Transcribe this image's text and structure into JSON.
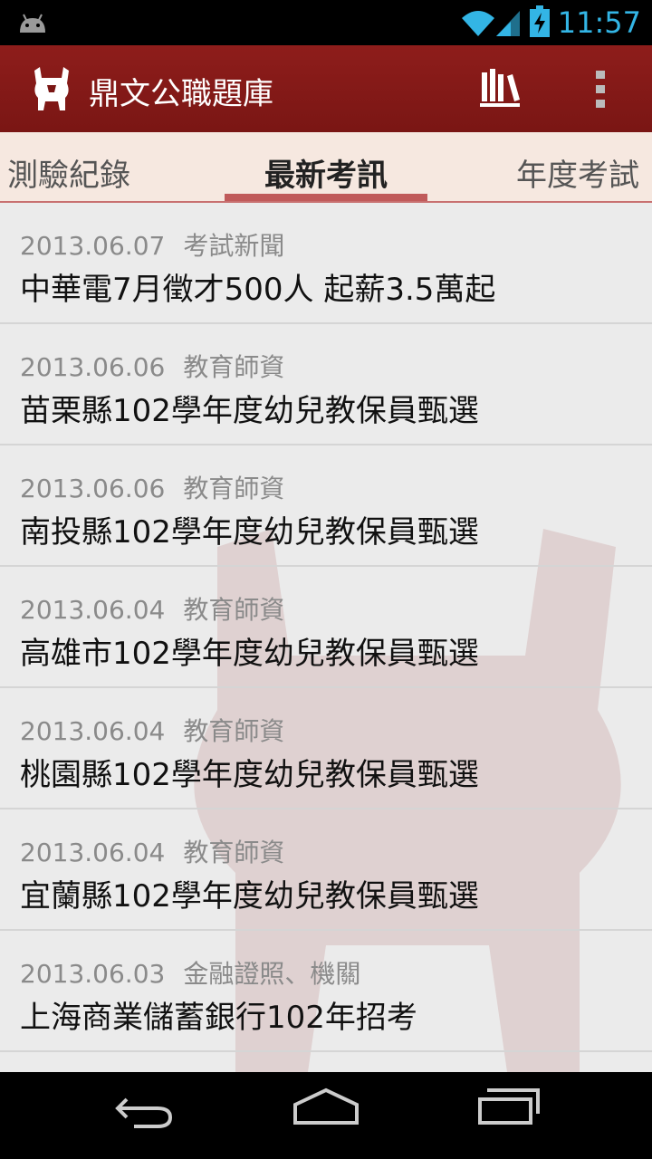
{
  "status": {
    "time": "11:57"
  },
  "app": {
    "title": "鼎文公職題庫"
  },
  "tabs": [
    "測驗紀錄",
    "最新考訊",
    "年度考試"
  ],
  "news": [
    {
      "date": "2013.06.07",
      "category": "考試新聞",
      "title": "中華電7月徵才500人 起薪3.5萬起"
    },
    {
      "date": "2013.06.06",
      "category": "教育師資",
      "title": "苗栗縣102學年度幼兒教保員甄選"
    },
    {
      "date": "2013.06.06",
      "category": "教育師資",
      "title": "南投縣102學年度幼兒教保員甄選"
    },
    {
      "date": "2013.06.04",
      "category": "教育師資",
      "title": "高雄市102學年度幼兒教保員甄選"
    },
    {
      "date": "2013.06.04",
      "category": "教育師資",
      "title": "桃園縣102學年度幼兒教保員甄選"
    },
    {
      "date": "2013.06.04",
      "category": "教育師資",
      "title": "宜蘭縣102學年度幼兒教保員甄選"
    },
    {
      "date": "2013.06.03",
      "category": "金融證照、機關",
      "title": "上海商業儲蓄銀行102年招考"
    }
  ],
  "colors": {
    "actionbar": "#8e1d1b",
    "status_accent": "#33b5e5",
    "tab_indicator": "#c05a5a"
  }
}
